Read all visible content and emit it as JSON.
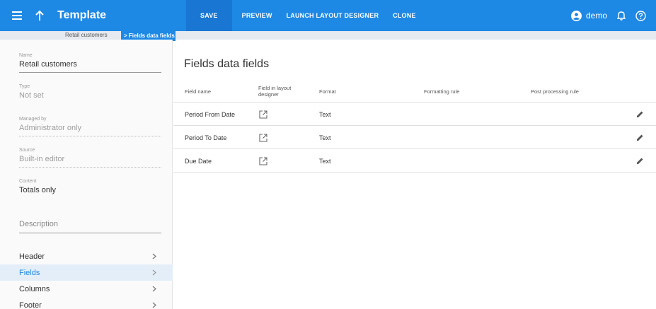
{
  "header": {
    "title": "Template",
    "toolbar": {
      "save": "SAVE",
      "preview": "PREVIEW",
      "launch": "LAUNCH LAYOUT DESIGNER",
      "clone": "CLONE"
    },
    "user": "demo"
  },
  "breadcrumb": {
    "previous": "Retail customers",
    "separator": ">",
    "current": "Fields data fields"
  },
  "sidebar": {
    "fields": [
      {
        "label": "Name",
        "value": "Retail customers"
      },
      {
        "label": "Type",
        "value": "Not set"
      },
      {
        "label": "Managed by",
        "value": "Administrator only"
      },
      {
        "label": "Source",
        "value": "Built-in editor"
      },
      {
        "label": "Content",
        "value": "Totals only"
      }
    ],
    "description_placeholder": "Description",
    "nav": [
      {
        "label": "Header"
      },
      {
        "label": "Fields"
      },
      {
        "label": "Columns"
      },
      {
        "label": "Footer"
      }
    ]
  },
  "main": {
    "title": "Fields data fields",
    "columns": {
      "field_name": "Field name",
      "layout_designer": "Field in layout designer",
      "format": "Format",
      "formatting_rule": "Formatting rule",
      "post_processing_rule": "Post processing rule"
    },
    "rows": [
      {
        "name": "Period From Date",
        "format": "Text",
        "formatting_rule": "",
        "post_rule": ""
      },
      {
        "name": "Period To Date",
        "format": "Text",
        "formatting_rule": "",
        "post_rule": ""
      },
      {
        "name": "Due Date",
        "format": "Text",
        "formatting_rule": "",
        "post_rule": ""
      }
    ]
  },
  "colors": {
    "primary": "#1e88e5",
    "save_button": "#1976d2",
    "breadcrumb_bg": "#e4eaf0",
    "active_nav_bg": "#e3eef8"
  }
}
